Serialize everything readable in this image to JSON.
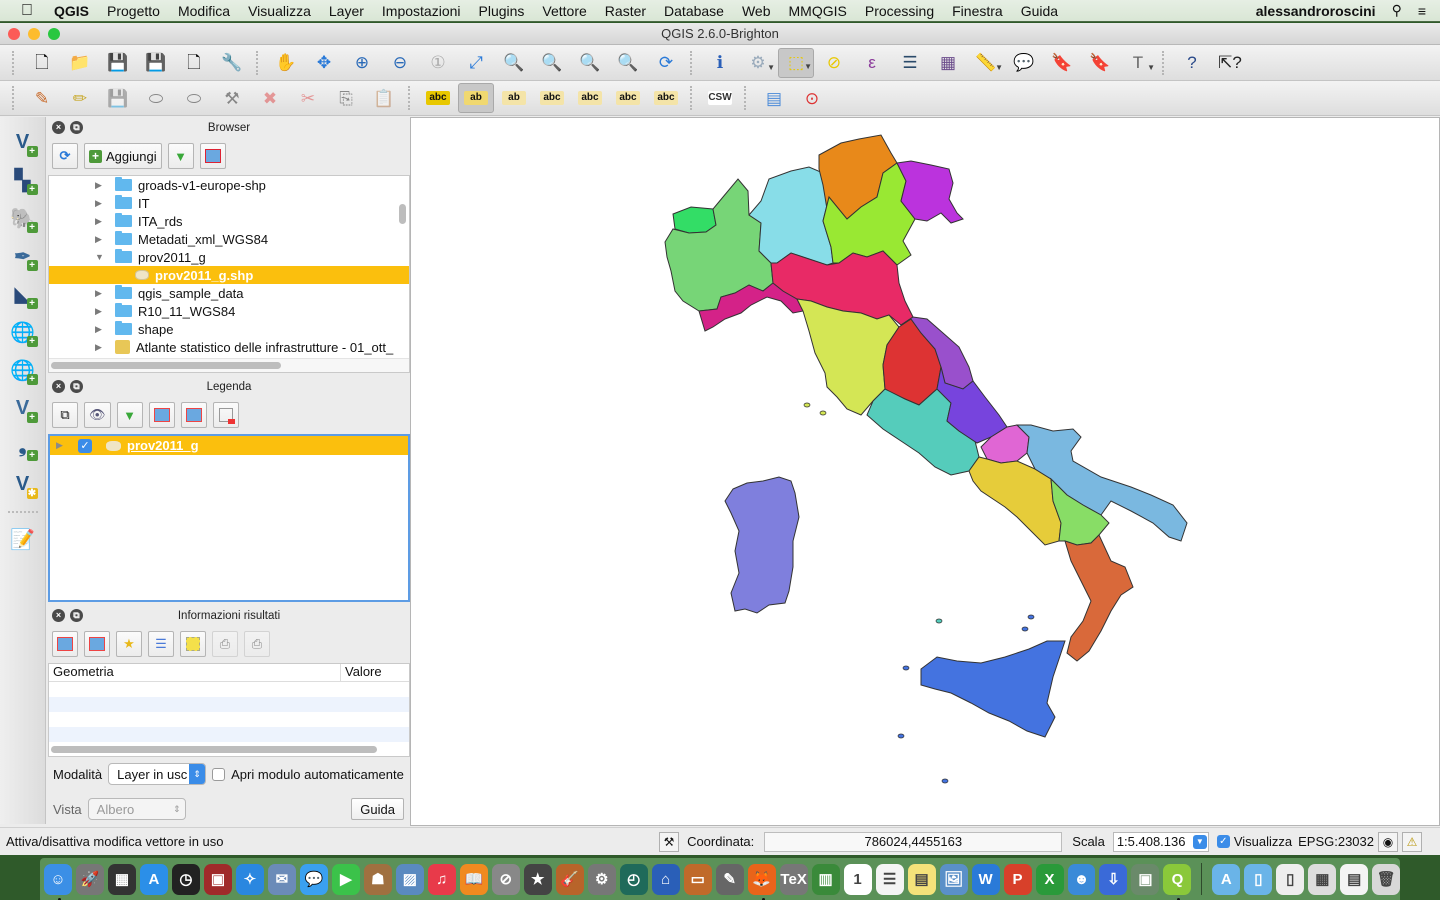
{
  "menubar": {
    "app": "QGIS",
    "items": [
      "Progetto",
      "Modifica",
      "Visualizza",
      "Layer",
      "Impostazioni",
      "Plugins",
      "Vettore",
      "Raster",
      "Database",
      "Web",
      "MMQGIS",
      "Processing",
      "Finestra",
      "Guida"
    ],
    "user": "alessandroroscini"
  },
  "window": {
    "title": "QGIS 2.6.0-Brighton"
  },
  "toolbar1": [
    {
      "name": "new-project-icon",
      "glyph": "🗋"
    },
    {
      "name": "open-project-icon",
      "glyph": "📁"
    },
    {
      "name": "save-project-icon",
      "glyph": "💾"
    },
    {
      "name": "save-as-icon",
      "glyph": "💾"
    },
    {
      "name": "new-print-composer-icon",
      "glyph": "🗋"
    },
    {
      "name": "composer-manager-icon",
      "glyph": "🔧"
    },
    {
      "name": "pan-icon",
      "glyph": "✋"
    },
    {
      "name": "pan-to-selection-icon",
      "glyph": "✥"
    },
    {
      "name": "zoom-in-icon",
      "glyph": "⊕"
    },
    {
      "name": "zoom-out-icon",
      "glyph": "⊖"
    },
    {
      "name": "zoom-native-icon",
      "glyph": "①"
    },
    {
      "name": "zoom-full-icon",
      "glyph": "⤢"
    },
    {
      "name": "zoom-to-selection-icon",
      "glyph": "🔍"
    },
    {
      "name": "zoom-to-layer-icon",
      "glyph": "🔍"
    },
    {
      "name": "zoom-last-icon",
      "glyph": "🔍"
    },
    {
      "name": "zoom-next-icon",
      "glyph": "🔍"
    },
    {
      "name": "refresh-icon",
      "glyph": "⟳"
    },
    {
      "name": "identify-icon",
      "glyph": "ℹ"
    },
    {
      "name": "run-feature-action-icon",
      "glyph": "⚙"
    },
    {
      "name": "select-features-icon",
      "glyph": "⬚"
    },
    {
      "name": "deselect-all-icon",
      "glyph": "⊘"
    },
    {
      "name": "select-by-expression-icon",
      "glyph": "ε"
    },
    {
      "name": "attribute-table-icon",
      "glyph": "☰"
    },
    {
      "name": "field-calculator-icon",
      "glyph": "▦"
    },
    {
      "name": "measure-icon",
      "glyph": "📏"
    },
    {
      "name": "map-tips-icon",
      "glyph": "💬"
    },
    {
      "name": "new-bookmark-icon",
      "glyph": "🔖"
    },
    {
      "name": "show-bookmarks-icon",
      "glyph": "🔖"
    },
    {
      "name": "text-annotation-icon",
      "glyph": "T"
    },
    {
      "name": "help-contents-icon",
      "glyph": "?"
    },
    {
      "name": "whats-this-icon",
      "glyph": "⇱?"
    }
  ],
  "toolbar2": [
    {
      "name": "current-edits-icon",
      "glyph": "✎"
    },
    {
      "name": "toggle-editing-icon",
      "glyph": "✏"
    },
    {
      "name": "save-layer-edits-icon",
      "glyph": "💾"
    },
    {
      "name": "add-feature-icon",
      "glyph": "⬭"
    },
    {
      "name": "move-feature-icon",
      "glyph": "⬭"
    },
    {
      "name": "node-tool-icon",
      "glyph": "⚒"
    },
    {
      "name": "delete-selected-icon",
      "glyph": "✖"
    },
    {
      "name": "cut-features-icon",
      "glyph": "✂"
    },
    {
      "name": "copy-features-icon",
      "glyph": "⎘"
    },
    {
      "name": "paste-features-icon",
      "glyph": "📋"
    },
    {
      "name": "layer-labeling-icon",
      "glyph": "abc"
    },
    {
      "name": "pin-labels-icon",
      "glyph": "ab"
    },
    {
      "name": "highlight-pinned-labels-icon",
      "glyph": "ab"
    },
    {
      "name": "show-hide-labels-icon",
      "glyph": "abc"
    },
    {
      "name": "move-label-icon",
      "glyph": "abc"
    },
    {
      "name": "rotate-label-icon",
      "glyph": "abc"
    },
    {
      "name": "change-label-icon",
      "glyph": "abc"
    },
    {
      "name": "csw-icon",
      "glyph": "CSW"
    },
    {
      "name": "table-manager-icon",
      "glyph": "▤"
    },
    {
      "name": "georeferencer-icon",
      "glyph": "⊙"
    }
  ],
  "vtool": [
    {
      "name": "add-vector-layer-icon",
      "glyph": "V"
    },
    {
      "name": "add-raster-layer-icon",
      "glyph": "▚"
    },
    {
      "name": "add-postgis-layer-icon",
      "glyph": "🐘"
    },
    {
      "name": "add-spatialite-layer-icon",
      "glyph": "✒"
    },
    {
      "name": "add-mssql-layer-icon",
      "glyph": "◣"
    },
    {
      "name": "add-wms-layer-icon",
      "glyph": "🌐"
    },
    {
      "name": "add-wcs-layer-icon",
      "glyph": "🌐"
    },
    {
      "name": "add-wfs-layer-icon",
      "glyph": "V"
    },
    {
      "name": "add-delimited-text-icon",
      "glyph": "❟"
    },
    {
      "name": "new-shapefile-layer-icon",
      "glyph": "V"
    },
    {
      "name": "gps-tools-icon",
      "glyph": "📝"
    }
  ],
  "browser": {
    "title": "Browser",
    "add_label": "Aggiungi",
    "items": [
      {
        "label": "groads-v1-europe-shp",
        "type": "folder",
        "expanded": false
      },
      {
        "label": "IT",
        "type": "folder",
        "expanded": false
      },
      {
        "label": "ITA_rds",
        "type": "folder",
        "expanded": false
      },
      {
        "label": "Metadati_xml_WGS84",
        "type": "folder",
        "expanded": false
      },
      {
        "label": "prov2011_g",
        "type": "folder",
        "expanded": true
      },
      {
        "label": "prov2011_g.shp",
        "type": "shapefile",
        "selected": true
      },
      {
        "label": "qgis_sample_data",
        "type": "folder",
        "expanded": false
      },
      {
        "label": "R10_11_WGS84",
        "type": "folder",
        "expanded": false
      },
      {
        "label": "shape",
        "type": "folder",
        "expanded": false
      },
      {
        "label": "Atlante statistico delle infrastrutture - 01_ott_",
        "type": "project",
        "expanded": false
      }
    ]
  },
  "legend": {
    "title": "Legenda",
    "layers": [
      {
        "label": "prov2011_g",
        "visible": true
      }
    ]
  },
  "info": {
    "title": "Informazioni risultati",
    "columns": [
      "Geometria",
      "Valore"
    ],
    "mode_label": "Modalità",
    "mode_value": "Layer in usc",
    "auto_open_label": "Apri modulo automaticamente",
    "view_label": "Vista",
    "view_value": "Albero",
    "help_label": "Guida"
  },
  "map": {
    "regions": [
      {
        "name": "Valle d'Aosta",
        "color": "#33dd66"
      },
      {
        "name": "Piemonte",
        "color": "#77d577"
      },
      {
        "name": "Lombardia",
        "color": "#88dde8"
      },
      {
        "name": "Trentino-Alto Adige",
        "color": "#e8891a"
      },
      {
        "name": "Veneto",
        "color": "#99e833"
      },
      {
        "name": "Friuli-Venezia Giulia",
        "color": "#bb33dd"
      },
      {
        "name": "Liguria",
        "color": "#d42288"
      },
      {
        "name": "Emilia-Romagna",
        "color": "#e82a66"
      },
      {
        "name": "Toscana",
        "color": "#d4e655"
      },
      {
        "name": "Umbria",
        "color": "#dd3333"
      },
      {
        "name": "Marche",
        "color": "#9950cc"
      },
      {
        "name": "Lazio",
        "color": "#55ccbb"
      },
      {
        "name": "Abruzzo",
        "color": "#7744dd"
      },
      {
        "name": "Molise",
        "color": "#e066d4"
      },
      {
        "name": "Campania",
        "color": "#e6cc3a"
      },
      {
        "name": "Puglia",
        "color": "#7ab8e0"
      },
      {
        "name": "Basilicata",
        "color": "#88dd66"
      },
      {
        "name": "Calabria",
        "color": "#d9693a"
      },
      {
        "name": "Sicilia",
        "color": "#4473e0"
      },
      {
        "name": "Sardegna",
        "color": "#7f7fdd"
      }
    ]
  },
  "status": {
    "message": "Attiva/disattiva modifica vettore in uso",
    "coord_label": "Coordinata:",
    "coord_value": "786024,4455163",
    "scale_label": "Scala",
    "scale_value": "1:5.408.136",
    "render_label": "Visualizza",
    "render_checked": true,
    "crs": "EPSG:23032"
  },
  "dock": [
    {
      "name": "finder-icon",
      "color": "#3b8fe6",
      "glyph": "☺",
      "running": true
    },
    {
      "name": "launchpad-icon",
      "color": "#777",
      "glyph": "🚀"
    },
    {
      "name": "mission-control-icon",
      "color": "#333",
      "glyph": "▦"
    },
    {
      "name": "app-store-icon",
      "color": "#2b8fe8",
      "glyph": "A"
    },
    {
      "name": "dashboard-icon",
      "color": "#222",
      "glyph": "◷"
    },
    {
      "name": "photo-booth-icon",
      "color": "#a02a2a",
      "glyph": "▣"
    },
    {
      "name": "safari-icon",
      "color": "#2a87e0",
      "glyph": "✧"
    },
    {
      "name": "mail-icon",
      "color": "#6b8bb8",
      "glyph": "✉"
    },
    {
      "name": "messages-icon",
      "color": "#3aa0f0",
      "glyph": "💬"
    },
    {
      "name": "facetime-icon",
      "color": "#3bc24a",
      "glyph": "▶"
    },
    {
      "name": "contacts-icon",
      "color": "#a07040",
      "glyph": "☗"
    },
    {
      "name": "iphoto-icon",
      "color": "#5a8ac0",
      "glyph": "▨"
    },
    {
      "name": "itunes-icon",
      "color": "#e83a4a",
      "glyph": "♫"
    },
    {
      "name": "ibooks-icon",
      "color": "#f08a20",
      "glyph": "📖"
    },
    {
      "name": "parental-controls-icon",
      "color": "#888",
      "glyph": "⊘"
    },
    {
      "name": "imovie-icon",
      "color": "#444",
      "glyph": "★"
    },
    {
      "name": "garageband-icon",
      "color": "#b8642a",
      "glyph": "🎸"
    },
    {
      "name": "system-preferences-icon",
      "color": "#777",
      "glyph": "⚙"
    },
    {
      "name": "time-machine-icon",
      "color": "#1f6a5a",
      "glyph": "◴"
    },
    {
      "name": "migration-assistant-icon",
      "color": "#2a5fb8",
      "glyph": "⌂"
    },
    {
      "name": "keynote-icon",
      "color": "#c06a2a",
      "glyph": "▭"
    },
    {
      "name": "script-editor-icon",
      "color": "#666",
      "glyph": "✎"
    },
    {
      "name": "firefox-icon",
      "color": "#e8641a",
      "glyph": "🦊",
      "running": true
    },
    {
      "name": "tex-shop-icon",
      "color": "#777",
      "glyph": "TeX"
    },
    {
      "name": "numbers-icon",
      "color": "#3a8a3a",
      "glyph": "▥"
    },
    {
      "name": "calendar-icon",
      "color": "#fff",
      "glyph": "1"
    },
    {
      "name": "reminders-icon",
      "color": "#f4f4f4",
      "glyph": "☰"
    },
    {
      "name": "notes-icon",
      "color": "#f4e27a",
      "glyph": "▤"
    },
    {
      "name": "preview-icon",
      "color": "#5a90c8",
      "glyph": "🖼"
    },
    {
      "name": "word-icon",
      "color": "#2a7ad8",
      "glyph": "W"
    },
    {
      "name": "powerpoint-icon",
      "color": "#d8402a",
      "glyph": "P"
    },
    {
      "name": "excel-icon",
      "color": "#2a9a3a",
      "glyph": "X"
    },
    {
      "name": "lync-icon",
      "color": "#3a8ad8",
      "glyph": "☻"
    },
    {
      "name": "transmission-icon",
      "color": "#3a6ad8",
      "glyph": "⇩"
    },
    {
      "name": "grass-gis-icon",
      "color": "#6a8a6a",
      "glyph": "▣"
    },
    {
      "name": "qgis-icon",
      "color": "#8ac83a",
      "glyph": "Q",
      "running": true
    },
    {
      "name": "applications-folder-icon",
      "color": "#6ab4e8",
      "glyph": "A"
    },
    {
      "name": "documents-folder-icon",
      "color": "#6ab4e8",
      "glyph": "▯"
    },
    {
      "name": "zip-archive-icon",
      "color": "#eee",
      "glyph": "▯"
    },
    {
      "name": "downloads-stack-icon",
      "color": "#ddd",
      "glyph": "▦"
    },
    {
      "name": "document-stack-icon",
      "color": "#f4f4f4",
      "glyph": "▤"
    },
    {
      "name": "trash-icon",
      "color": "#d8d8d8",
      "glyph": "🗑"
    }
  ]
}
